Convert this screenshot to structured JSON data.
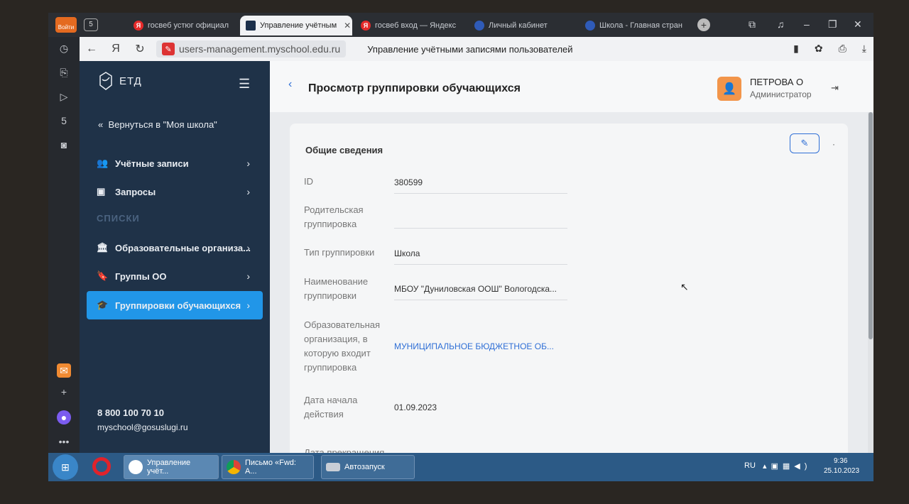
{
  "browser": {
    "tabs": [
      {
        "label": "госвеб устюг официал",
        "icon": "yandex-icon"
      },
      {
        "label": "Управление учётным",
        "icon": "etd-icon",
        "active": true
      },
      {
        "label": "госвеб вход — Яндекс",
        "icon": "yandex-icon"
      },
      {
        "label": "Личный кабинет",
        "icon": "globe-icon"
      },
      {
        "label": "Школа - Главная стран",
        "icon": "globe-icon"
      }
    ],
    "login_badge": "Войти",
    "tab_count": "5",
    "address": "users-management.myschool.edu.ru",
    "page_title": "Управление учётными записями пользователей"
  },
  "sidebar": {
    "logo_text": "ЕТД",
    "back_label": "Вернуться в \"Моя школа\"",
    "items": [
      {
        "label": "Учётные записи",
        "icon": "users-icon"
      },
      {
        "label": "Запросы",
        "icon": "inbox-icon"
      }
    ],
    "section_label": "СПИСКИ",
    "list_items": [
      {
        "label": "Образовательные организа...",
        "icon": "institution-icon"
      },
      {
        "label": "Группы ОО",
        "icon": "bookmark-icon"
      },
      {
        "label": "Группировки обучающихся",
        "icon": "graduation-cap-icon",
        "active": true
      }
    ],
    "phone": "8 800 100 70 10",
    "email": "myschool@gosuslugi.ru"
  },
  "header": {
    "title": "Просмотр группировки обучающихся",
    "user_name": "ПЕТРОВА О",
    "user_role": "Администратор"
  },
  "card": {
    "title": "Общие сведения",
    "fields": [
      {
        "label": "ID",
        "value": "380599"
      },
      {
        "label": "Родительская группировка",
        "value": ""
      },
      {
        "label": "Тип группировки",
        "value": "Школа"
      },
      {
        "label": "Наименование группировки",
        "value": "МБОУ \"Дуниловская ООШ\" Вологодска..."
      },
      {
        "label": "Образовательная организация, в которую входит группировка",
        "value": "МУНИЦИПАЛЬНОЕ БЮДЖЕТНОЕ ОБ..."
      },
      {
        "label": "Дата начала действия",
        "value": "01.09.2023"
      },
      {
        "label": "Дата прекращения",
        "value": ""
      }
    ]
  },
  "taskbar": {
    "buttons": [
      {
        "label": "Управление учёт..."
      },
      {
        "label": "Письмо «Fwd: А..."
      },
      {
        "label": "Автозапуск"
      }
    ],
    "lang": "RU",
    "time": "9:36",
    "date": "25.10.2023"
  },
  "colors": {
    "sidebar_bg": "#1f3248",
    "accent": "#2196e8",
    "link": "#2f6fd6",
    "avatar": "#f2954a"
  }
}
